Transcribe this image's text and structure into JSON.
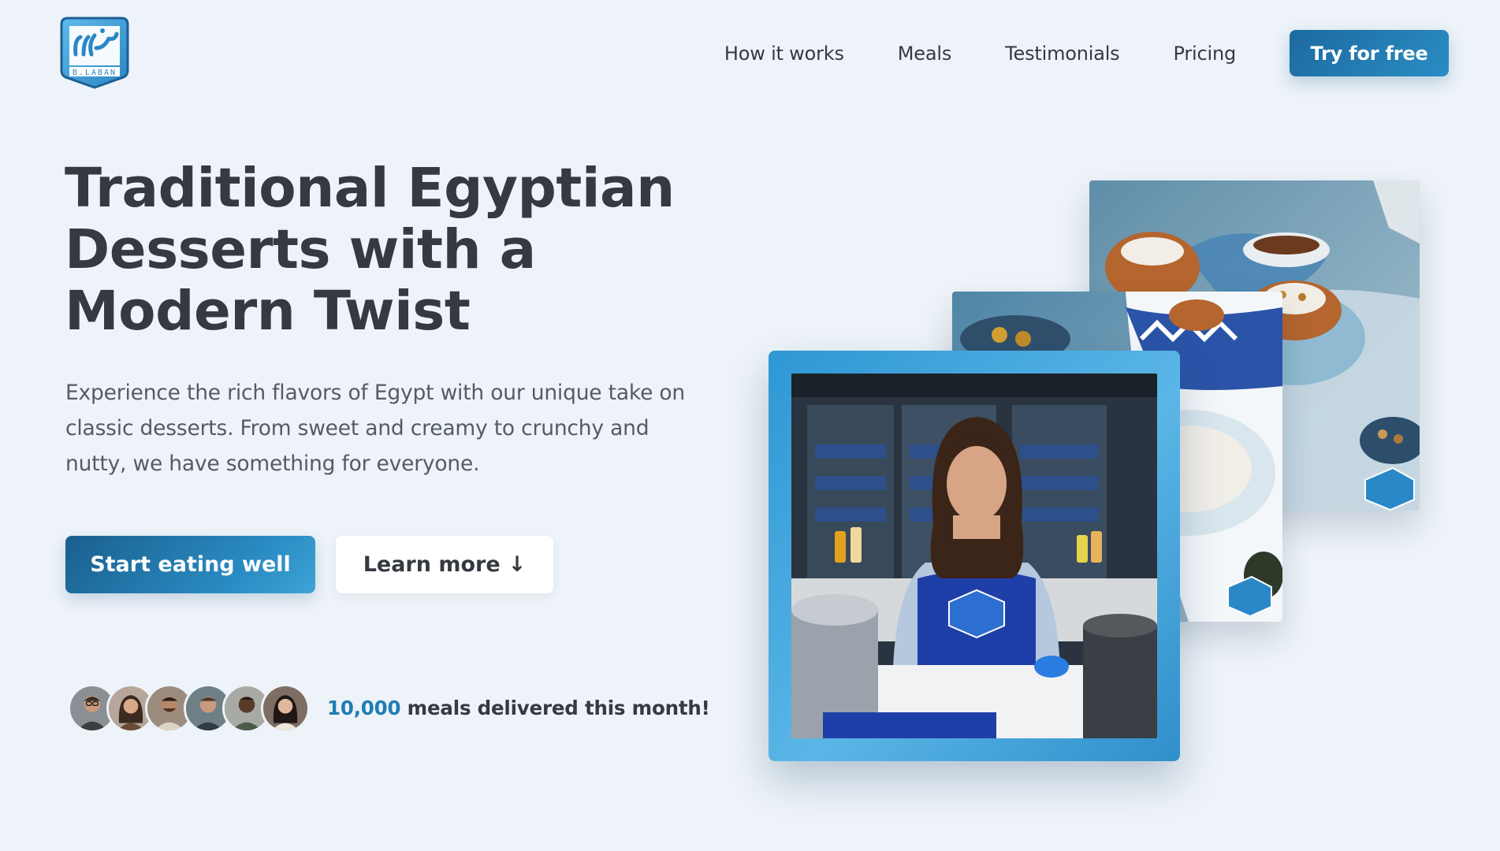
{
  "brand": {
    "logo_name": "B.LABAN",
    "accent": "#1f7db3",
    "dark_text": "#343a40"
  },
  "nav": {
    "links": [
      "How it works",
      "Meals",
      "Testimonials",
      "Pricing"
    ],
    "cta": "Try for free"
  },
  "hero": {
    "title": "Traditional Egyptian Desserts with a Modern Twist",
    "description": "Experience the rich flavors of Egypt with our unique take on classic desserts. From sweet and creamy to crunchy and nutty, we have something for everyone.",
    "primary_button": "Start eating well",
    "secondary_button": "Learn more",
    "secondary_icon": "arrow-down-icon",
    "secondary_arrow": "↓"
  },
  "social_proof": {
    "count": "10,000",
    "text": " meals delivered this month!",
    "avatars": [
      "customer-1",
      "customer-2",
      "customer-3",
      "customer-4",
      "customer-5",
      "customer-6"
    ]
  },
  "images": [
    {
      "id": "dessert-bowls-photo"
    },
    {
      "id": "dessert-table-photo"
    },
    {
      "id": "chef-in-kitchen-photo"
    }
  ]
}
